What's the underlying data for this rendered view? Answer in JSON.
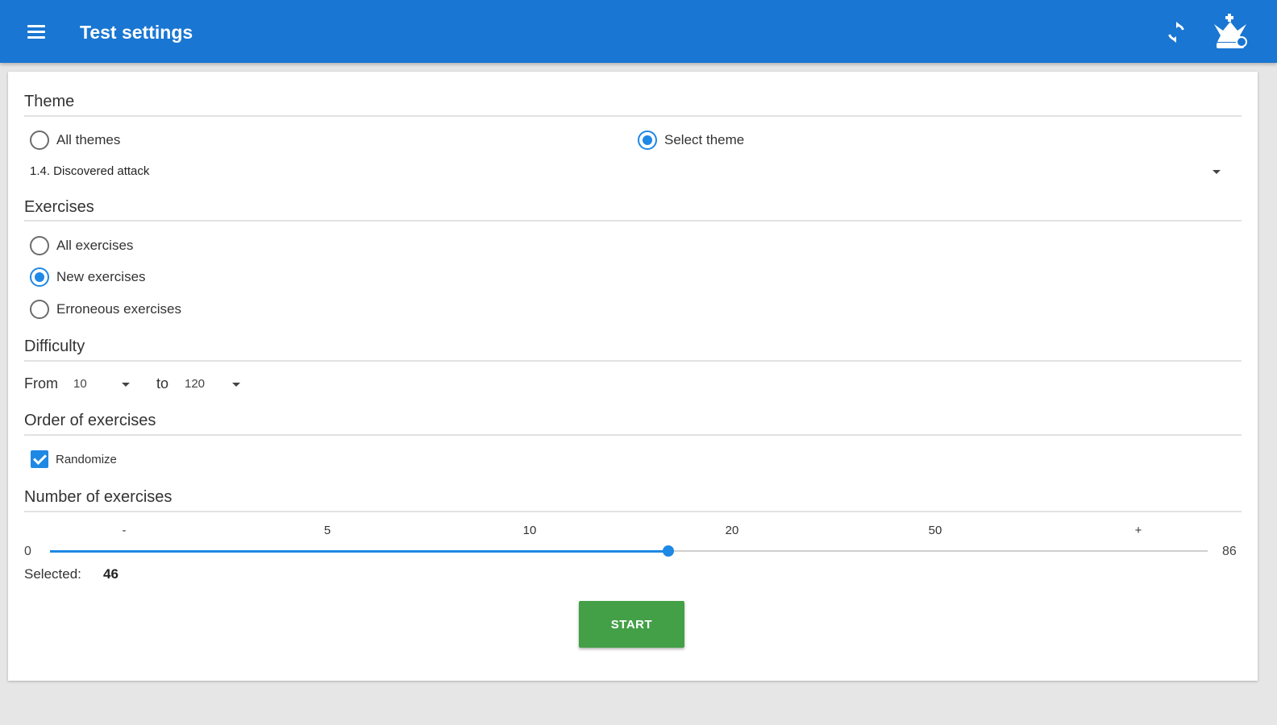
{
  "appbar": {
    "title": "Test settings",
    "menu_icon": "menu-icon",
    "refresh_icon": "refresh-icon",
    "logo_icon": "chess-king-logo-icon"
  },
  "theme": {
    "heading": "Theme",
    "options": [
      {
        "label": "All themes",
        "selected": false
      },
      {
        "label": "Select theme",
        "selected": true
      }
    ],
    "selected_theme": "1.4. Discovered attack"
  },
  "exercises": {
    "heading": "Exercises",
    "options": [
      {
        "label": "All exercises",
        "selected": false
      },
      {
        "label": "New exercises",
        "selected": true
      },
      {
        "label": "Erroneous exercises",
        "selected": false
      }
    ]
  },
  "difficulty": {
    "heading": "Difficulty",
    "from_label": "From",
    "from_value": "10",
    "to_label": "to",
    "to_value": "120"
  },
  "order": {
    "heading": "Order of exercises",
    "randomize_label": "Randomize",
    "randomize_checked": true
  },
  "number": {
    "heading": "Number of exercises",
    "ticks": [
      "-",
      "5",
      "10",
      "20",
      "50",
      "+"
    ],
    "min": "0",
    "max": "86",
    "selected_label": "Selected:",
    "selected_value": "46",
    "slider_fraction": 0.534
  },
  "start_label": "START",
  "colors": {
    "appbar": "#1976d2",
    "accent": "#1e88e5",
    "start_button": "#43a047"
  }
}
